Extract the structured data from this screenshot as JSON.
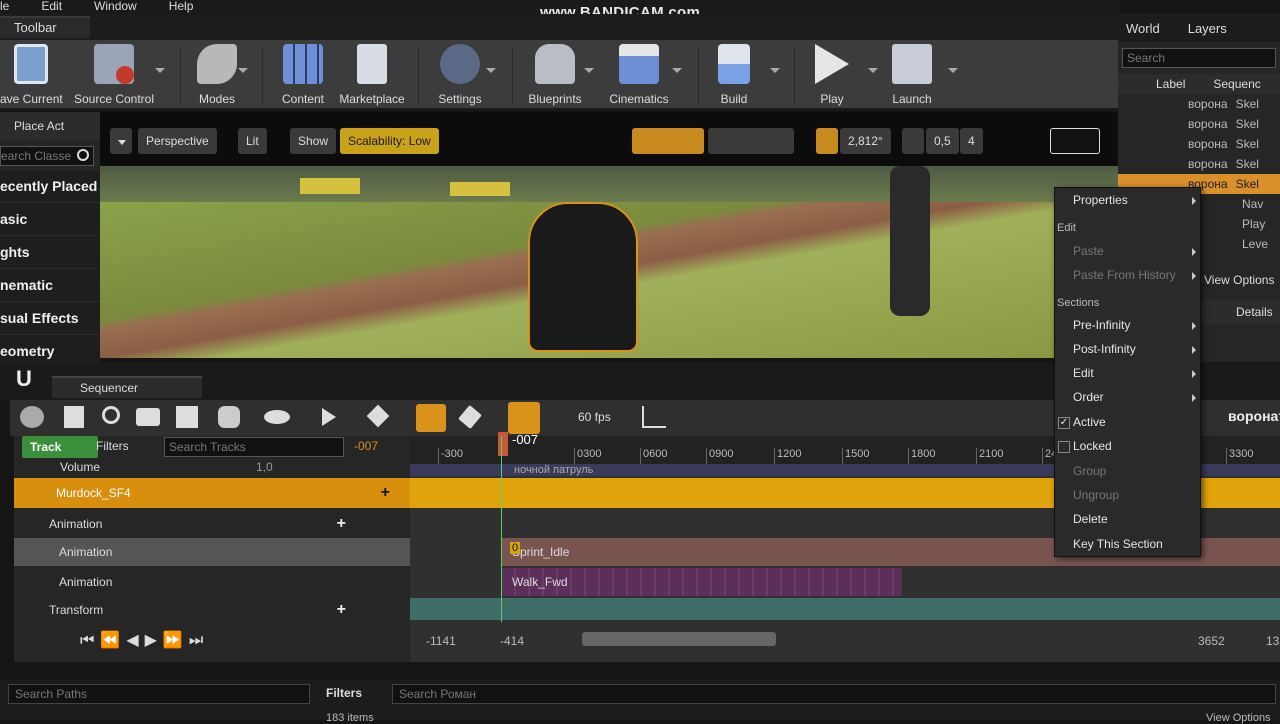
{
  "menu": [
    "le",
    "Edit",
    "Window",
    "Help"
  ],
  "watermark": "www.BANDICAM.com",
  "toolbar_tab": "Toolbar",
  "toolbar": [
    {
      "label": "ave Current",
      "icon": "save-icon"
    },
    {
      "label": "Source Control",
      "icon": "source-control-icon"
    },
    {
      "label": "Modes",
      "icon": "modes-icon"
    },
    {
      "label": "Content",
      "icon": "content-icon"
    },
    {
      "label": "Marketplace",
      "icon": "marketplace-icon"
    },
    {
      "label": "Settings",
      "icon": "settings-icon"
    },
    {
      "label": "Blueprints",
      "icon": "blueprints-icon"
    },
    {
      "label": "Cinematics",
      "icon": "cinematics-icon"
    },
    {
      "label": "Build",
      "icon": "build-icon"
    },
    {
      "label": "Play",
      "icon": "play-icon"
    },
    {
      "label": "Launch",
      "icon": "launch-icon"
    }
  ],
  "place_actors": {
    "title": "Place Act",
    "search_placeholder": "earch Classe",
    "categories": [
      "ecently Placed",
      "asic",
      "ghts",
      "nematic",
      "sual Effects",
      "eometry"
    ]
  },
  "viewport": {
    "perspective": "Perspective",
    "lit": "Lit",
    "show": "Show",
    "scalability": "Scalability: Low",
    "angle": "2,812°",
    "scale": "0,5",
    "cam_speed": "4"
  },
  "world_outliner": {
    "tabs": [
      "World",
      "Layers"
    ],
    "search_placeholder": "Search",
    "col_label": "Label",
    "col_seq": "Sequenc",
    "rows": [
      {
        "label": "ворона",
        "type": "Skel"
      },
      {
        "label": "ворона",
        "type": "Skel"
      },
      {
        "label": "ворона",
        "type": "Skel"
      },
      {
        "label": "ворона",
        "type": "Skel"
      },
      {
        "label": "ворона",
        "type": "Skel"
      }
    ],
    "extra": [
      "Nav",
      "Play",
      "Leve"
    ],
    "view_options": "View Options",
    "details": "Details"
  },
  "context_menu": {
    "properties": "Properties",
    "section_edit": "Edit",
    "paste": "Paste",
    "paste_history": "Paste From History",
    "section_sections": "Sections",
    "pre_infinity": "Pre-Infinity",
    "post_infinity": "Post-Infinity",
    "edit": "Edit",
    "order": "Order",
    "active": "Active",
    "locked": "Locked",
    "group": "Group",
    "ungroup": "Ungroup",
    "delete": "Delete",
    "key_section": "Key This Section"
  },
  "sequencer": {
    "tab": "Sequencer",
    "fps": "60 fps",
    "track_btn": "Track",
    "filters": "Filters",
    "search_placeholder": "Search Tracks",
    "frame": "-007",
    "playhead": "-007",
    "actor_name": "воронат",
    "ruler": [
      "-300",
      "0300",
      "0600",
      "0900",
      "1200",
      "1500",
      "1800",
      "2100",
      "24",
      "3300"
    ],
    "tracks": [
      {
        "name": "Volume",
        "value": "1,0"
      },
      {
        "name": "Murdock_SF4"
      },
      {
        "name": "Animation"
      },
      {
        "name": "Animation"
      },
      {
        "name": "Animation"
      },
      {
        "name": "Transform"
      }
    ],
    "sections": {
      "top": "ночной патруль",
      "sprint": "Sprint_Idle",
      "walk": "Walk_Fwd",
      "key_badge": "0"
    },
    "range": [
      "-1141",
      "-414",
      "3652",
      "13"
    ]
  },
  "content_browser": {
    "search_paths": "Search Paths",
    "filters": "Filters",
    "search": "Search Роман",
    "items": "183 items",
    "view_options": "View Options"
  }
}
